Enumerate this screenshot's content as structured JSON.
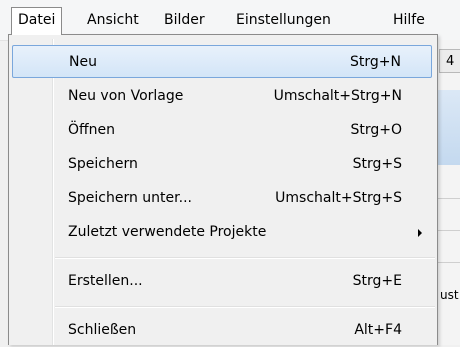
{
  "menubar": {
    "items": [
      {
        "label": "Datei"
      },
      {
        "label": "Ansicht"
      },
      {
        "label": "Bilder"
      },
      {
        "label": "Einstellungen"
      },
      {
        "label": "Hilfe"
      }
    ]
  },
  "background": {
    "tab_label": "4",
    "partial_text": "ust"
  },
  "file_menu": {
    "items": [
      {
        "label": "Neu",
        "shortcut": "Strg+N"
      },
      {
        "label": "Neu von Vorlage",
        "shortcut": "Umschalt+Strg+N"
      },
      {
        "label": "Öffnen",
        "shortcut": "Strg+O"
      },
      {
        "label": "Speichern",
        "shortcut": "Strg+S"
      },
      {
        "label": "Speichern unter...",
        "shortcut": "Umschalt+Strg+S"
      },
      {
        "label": "Zuletzt verwendete Projekte",
        "shortcut": ""
      },
      {
        "label": "Erstellen...",
        "shortcut": "Strg+E"
      },
      {
        "label": "Schließen",
        "shortcut": "Alt+F4"
      }
    ],
    "submenu_icon": "chevron-right-icon"
  },
  "colors": {
    "highlight_border": "#7aa7dc",
    "highlight_fill": "#d3e5f7"
  }
}
